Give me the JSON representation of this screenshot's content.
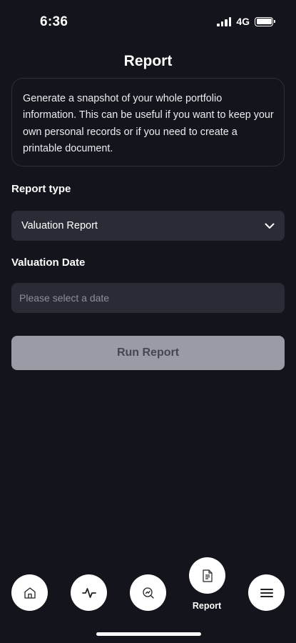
{
  "status_bar": {
    "time": "6:36",
    "network": "4G",
    "battery_level": 1.0
  },
  "header": {
    "title": "Report"
  },
  "intro": {
    "text": "Generate a snapshot of your whole portfolio information. This can be useful if you want to keep your own personal records or if you need to create a printable document."
  },
  "report_type": {
    "label": "Report type",
    "selected": "Valuation Report",
    "icon": "chevron-down-icon"
  },
  "valuation_date": {
    "label": "Valuation Date",
    "value": "",
    "placeholder": "Please select a date"
  },
  "run_button": {
    "label": "Run Report"
  },
  "bottom_nav": {
    "items": [
      {
        "icon": "home-icon",
        "label": ""
      },
      {
        "icon": "activity-icon",
        "label": ""
      },
      {
        "icon": "search-document-icon",
        "label": ""
      },
      {
        "icon": "report-document-icon",
        "label": "Report",
        "active": true
      },
      {
        "icon": "menu-icon",
        "label": ""
      }
    ]
  },
  "colors": {
    "background": "#13141c",
    "field_background": "#2a2c35",
    "button_disabled": "#9a9ca5",
    "nav_button": "#ffffff"
  }
}
